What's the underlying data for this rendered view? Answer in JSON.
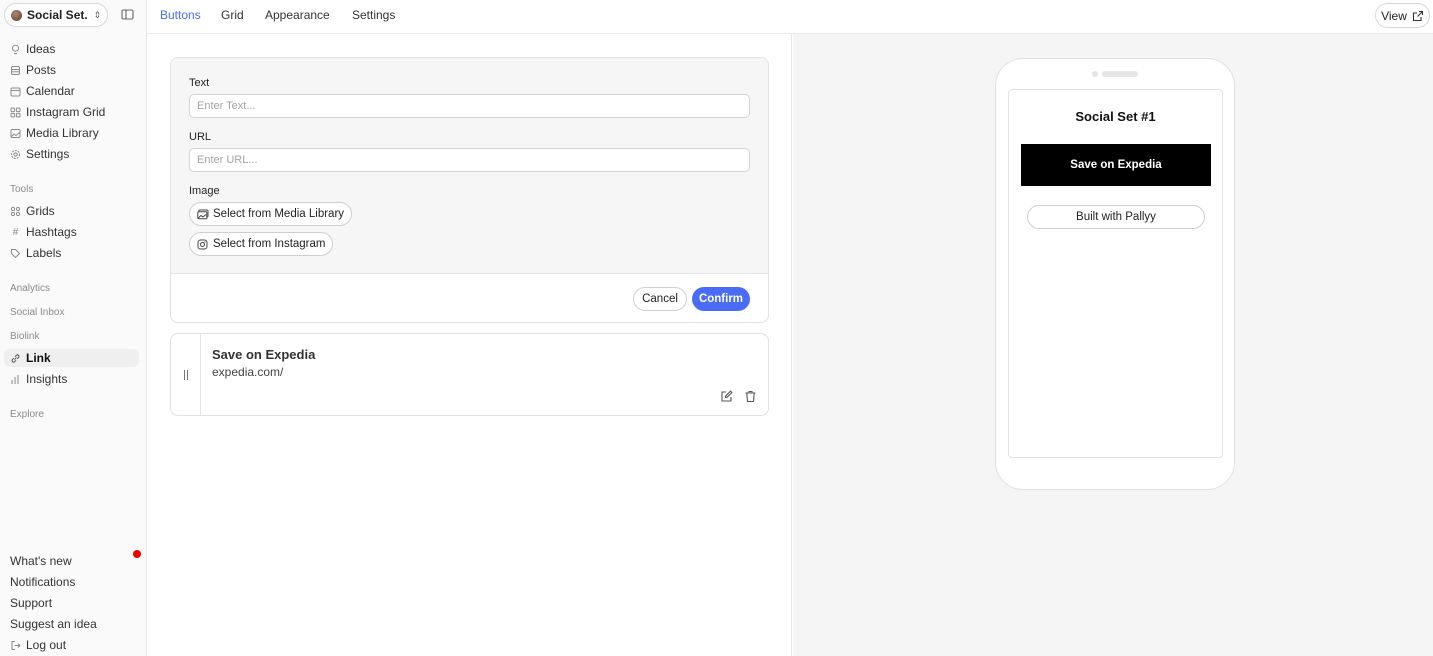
{
  "sidebar": {
    "workspace_name": "Social Set...",
    "nav": [
      {
        "label": "Ideas",
        "icon": "lightbulb-icon"
      },
      {
        "label": "Posts",
        "icon": "stack-icon"
      },
      {
        "label": "Calendar",
        "icon": "calendar-icon"
      },
      {
        "label": "Instagram Grid",
        "icon": "grid-icon"
      },
      {
        "label": "Media Library",
        "icon": "image-icon"
      },
      {
        "label": "Settings",
        "icon": "gear-icon"
      }
    ],
    "tools_label": "Tools",
    "tools": [
      {
        "label": "Grids",
        "icon": "grid-icon"
      },
      {
        "label": "Hashtags",
        "icon": "hash-icon"
      },
      {
        "label": "Labels",
        "icon": "tag-icon"
      }
    ],
    "analytics_label": "Analytics",
    "social_inbox_label": "Social Inbox",
    "biolink_label": "Biolink",
    "biolink": [
      {
        "label": "Link",
        "icon": "link-icon",
        "active": true
      },
      {
        "label": "Insights",
        "icon": "bar-chart-icon"
      }
    ],
    "explore_label": "Explore",
    "bottom": {
      "whats_new": "What's new",
      "notifications": "Notifications",
      "support": "Support",
      "suggest": "Suggest an idea",
      "logout": "Log out"
    }
  },
  "topbar": {
    "tabs": [
      "Buttons",
      "Grid",
      "Appearance",
      "Settings"
    ],
    "active_tab": "Buttons",
    "view_label": "View"
  },
  "form": {
    "text_label": "Text",
    "text_placeholder": "Enter Text...",
    "url_label": "URL",
    "url_placeholder": "Enter URL...",
    "image_label": "Image",
    "media_library_button": "Select from Media Library",
    "instagram_button": "Select from Instagram",
    "cancel": "Cancel",
    "confirm": "Confirm"
  },
  "link_item": {
    "title": "Save on Expedia",
    "url": "expedia.com/"
  },
  "preview": {
    "title": "Social Set #1",
    "button_label": "Save on Expedia",
    "built_with": "Built with Pallyy"
  },
  "colors": {
    "accent": "#4a6cf7",
    "notification_dot": "#e00000",
    "preview_button": "#000000"
  }
}
